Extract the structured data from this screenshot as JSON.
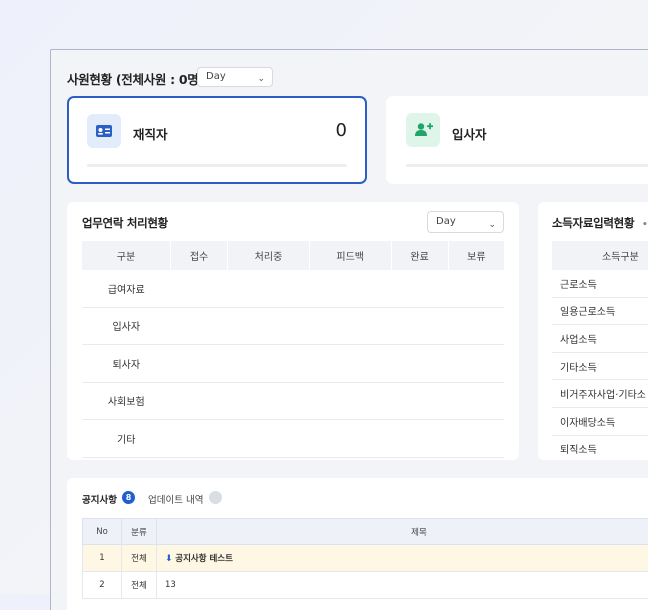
{
  "header": {
    "title": "사원현황 (전체사원 : 0명)",
    "period_select": "Day"
  },
  "cards": [
    {
      "label": "재직자",
      "value": "0",
      "icon": "id-card-icon",
      "accent": "#2b5fc6",
      "icon_bg": "#e3ecfb"
    },
    {
      "label": "입사자",
      "icon": "user-plus-icon",
      "accent": "#1fa56a",
      "icon_bg": "#e0f5ea"
    }
  ],
  "task_status": {
    "title": "업무연락 처리현황",
    "period_select": "Day",
    "columns": [
      "구분",
      "접수",
      "처리중",
      "피드백",
      "완료",
      "보류"
    ],
    "rows": [
      "급여자료",
      "입사자",
      "퇴사자",
      "사회보험",
      "기타"
    ]
  },
  "income_status": {
    "title": "소득자료입력현황",
    "column": "소득구분",
    "rows": [
      "근로소득",
      "일용근로소득",
      "사업소득",
      "기타소득",
      "비거주자사업·기타소",
      "이자배당소득",
      "퇴직소득"
    ]
  },
  "notice": {
    "tab_notice": "공지사항",
    "tab_notice_count": "8",
    "tab_updates": "업데이트 내역",
    "columns": [
      "No",
      "분류",
      "제목"
    ],
    "rows": [
      {
        "no": "1",
        "category": "전체",
        "title": "공지사항 테스트",
        "pinned": true
      },
      {
        "no": "2",
        "category": "전체",
        "title": "13",
        "pinned": false
      }
    ]
  }
}
